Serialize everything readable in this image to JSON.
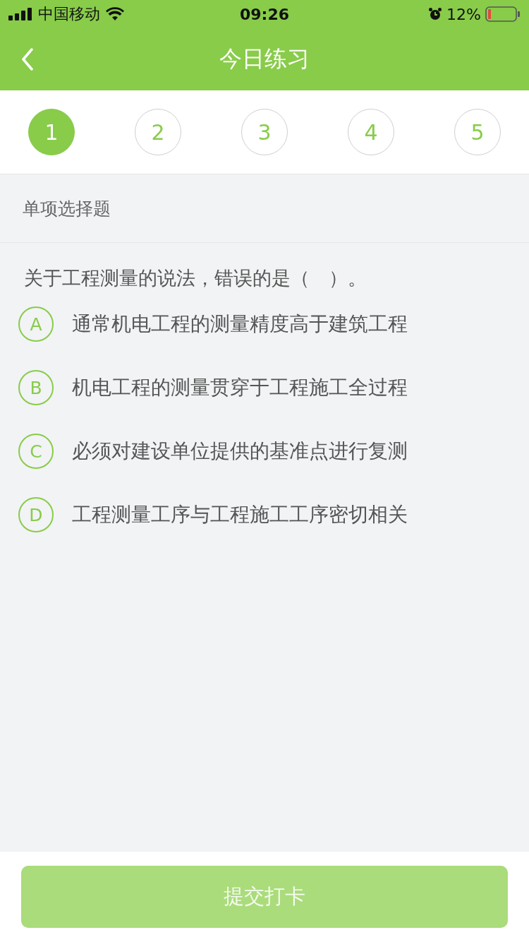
{
  "status_bar": {
    "carrier": "中国移动",
    "time": "09:26",
    "battery": "12%"
  },
  "nav": {
    "title": "今日练习"
  },
  "steps": [
    {
      "label": "1",
      "selected": true
    },
    {
      "label": "2",
      "selected": false
    },
    {
      "label": "3",
      "selected": false
    },
    {
      "label": "4",
      "selected": false
    },
    {
      "label": "5",
      "selected": false
    }
  ],
  "section": "单项选择题",
  "question": "关于工程测量的说法，错误的是（　）。",
  "options": [
    {
      "letter": "A",
      "text": "通常机电工程的测量精度高于建筑工程",
      "selected": false
    },
    {
      "letter": "B",
      "text": "机电工程的测量贯穿于工程施工全过程",
      "selected": false
    },
    {
      "letter": "C",
      "text": "必须对建设单位提供的基准点进行复测",
      "selected": false
    },
    {
      "letter": "D",
      "text": "工程测量工序与工程施工工序密切相关",
      "selected": false
    }
  ],
  "submit": {
    "label": "提交打卡",
    "disabled": true
  }
}
